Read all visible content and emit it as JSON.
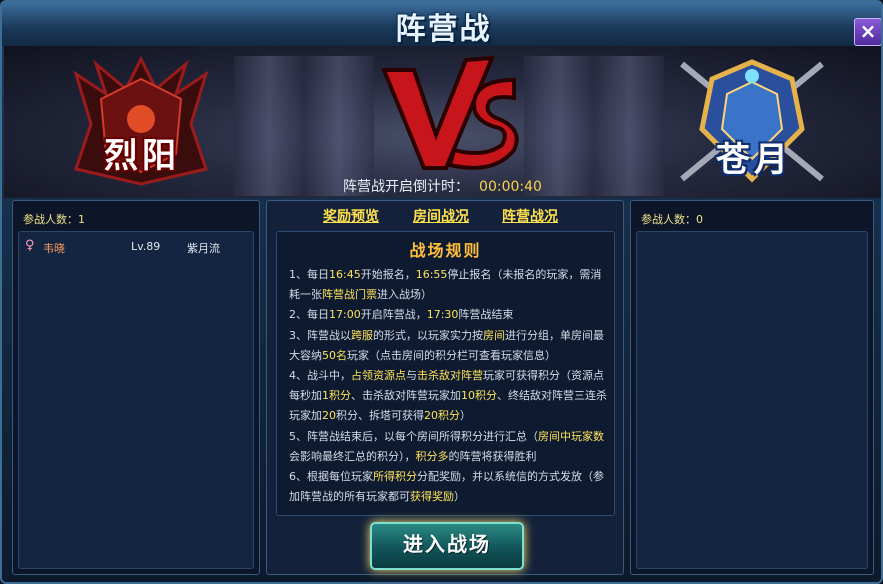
{
  "window": {
    "title": "阵营战",
    "close_label": "×"
  },
  "banner": {
    "left_faction": "烈阳",
    "right_faction": "苍月",
    "vs_label": "VS",
    "countdown_label": "阵营战开启倒计时：",
    "countdown_value": "00:00:40"
  },
  "left_panel": {
    "count_label": "参战人数：1",
    "players": [
      {
        "gender_icon": "female-icon",
        "name": "韦晓",
        "level": "Lv.89",
        "server": "紫月流"
      }
    ]
  },
  "right_panel": {
    "count_label": "参战人数：0",
    "players": []
  },
  "center": {
    "tabs": [
      "奖励预览",
      "房间战况",
      "阵营战况"
    ],
    "rules_title": "战场规则",
    "rules": [
      [
        {
          "t": "1、每日"
        },
        {
          "t": "16:45",
          "h": 1
        },
        {
          "t": "开始报名，"
        },
        {
          "t": "16:55",
          "h": 1
        },
        {
          "t": "停止报名（未报名的玩家，需消耗一张"
        },
        {
          "t": "阵营战门票",
          "h": 1
        },
        {
          "t": "进入战场）"
        }
      ],
      [
        {
          "t": "2、每日"
        },
        {
          "t": "17:00",
          "h": 1
        },
        {
          "t": "开启阵营战，"
        },
        {
          "t": "17:30",
          "h": 1
        },
        {
          "t": "阵营战结束"
        }
      ],
      [
        {
          "t": "3、阵营战以"
        },
        {
          "t": "跨服",
          "h": 1
        },
        {
          "t": "的形式，以玩家实力按"
        },
        {
          "t": "房间",
          "h": 1
        },
        {
          "t": "进行分组，单房间最大容纳"
        },
        {
          "t": "50名",
          "h": 1
        },
        {
          "t": "玩家（点击房间的积分栏可查看玩家信息）"
        }
      ],
      [
        {
          "t": "4、战斗中，"
        },
        {
          "t": "占领资源点",
          "h": 1
        },
        {
          "t": "与"
        },
        {
          "t": "击杀敌对阵营",
          "h": 1
        },
        {
          "t": "玩家可获得积分（资源点每秒加"
        },
        {
          "t": "1积分",
          "h": 1
        },
        {
          "t": "、击杀敌对阵营玩家加"
        },
        {
          "t": "10积分",
          "h": 1
        },
        {
          "t": "、终结敌对阵营三连杀玩家加"
        },
        {
          "t": "20",
          "h": 1
        },
        {
          "t": "积分、拆塔可获得"
        },
        {
          "t": "20积分",
          "h": 1
        },
        {
          "t": "）"
        }
      ],
      [
        {
          "t": "5、阵营战结束后，以每个房间所得积分进行汇总（"
        },
        {
          "t": "房间中玩家数",
          "h": 1
        },
        {
          "t": "会影响最终汇总的积分），"
        },
        {
          "t": "积分多",
          "h": 1
        },
        {
          "t": "的阵营将获得胜利"
        }
      ],
      [
        {
          "t": "6、根据每位玩家"
        },
        {
          "t": "所得积分",
          "h": 1
        },
        {
          "t": "分配奖励，并以系统信的方式发放（参加阵营战的所有玩家都可"
        },
        {
          "t": "获得奖励",
          "h": 1
        },
        {
          "t": "）"
        }
      ]
    ],
    "enter_button": "进入战场"
  },
  "colors": {
    "highlight": "#ffe35a",
    "tab": "#ffe14d",
    "accent": "#7fe0d2"
  }
}
